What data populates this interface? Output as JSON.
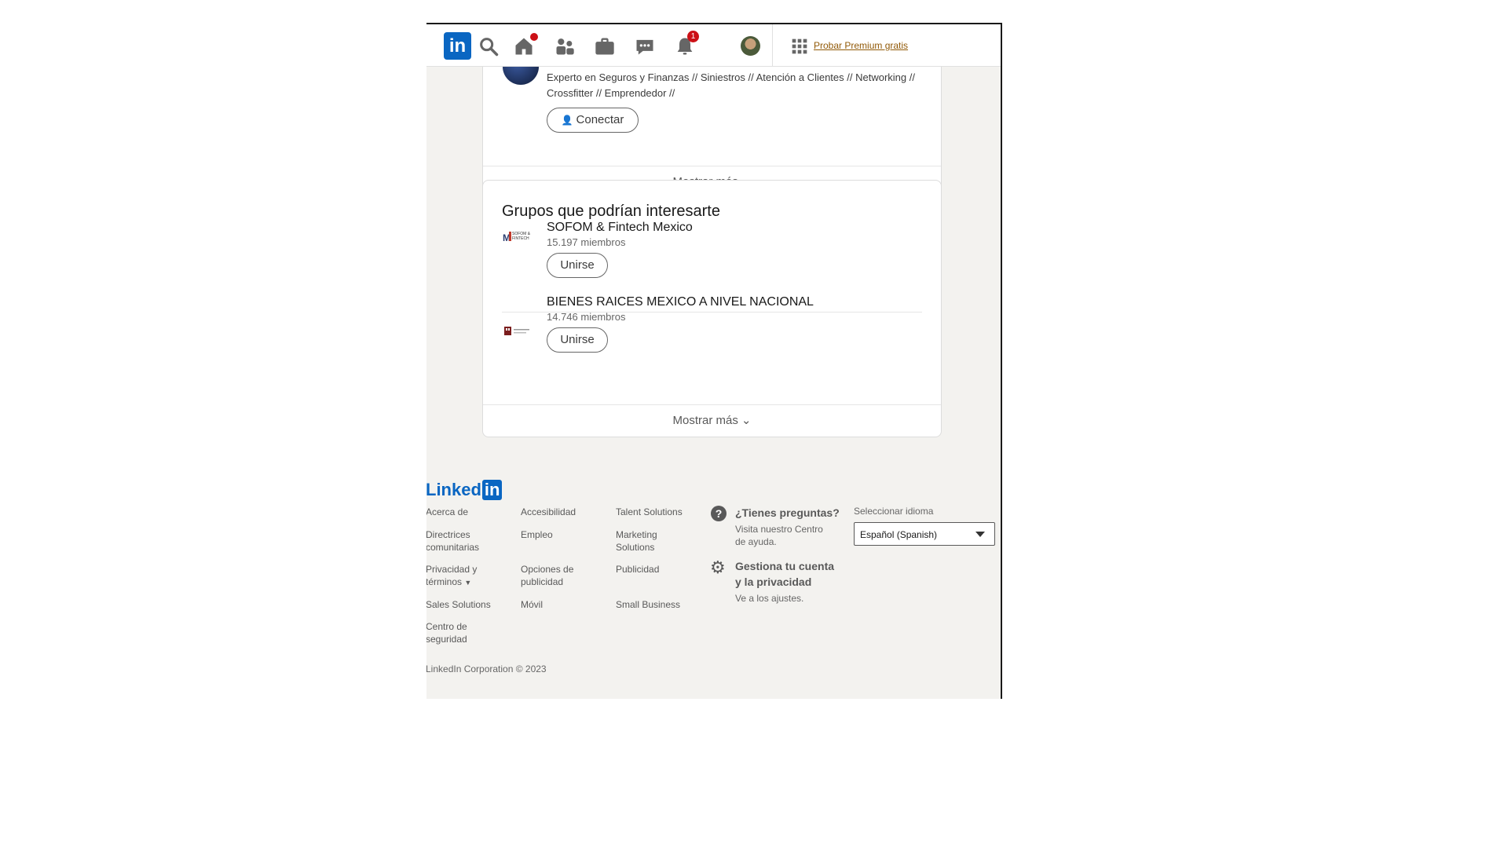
{
  "nav": {
    "logo": "in",
    "messaging_badge": "",
    "home_badge": "",
    "notifications_badge": "1",
    "premium_link": "Probar Premium gratis"
  },
  "people_card": {
    "headline": "Experto en Seguros y Finanzas // Siniestros // Atención a Clientes // Networking // Crossfitter // Emprendedor //",
    "connect_label": "Conectar",
    "show_more": "Mostrar más"
  },
  "groups_card": {
    "title": "Grupos que podrían interesarte",
    "groups": [
      {
        "name": "SOFOM & Fintech Mexico",
        "members": "15.197 miembros",
        "join_label": "Unirse",
        "logo_text": "SOFOM & FINTECH"
      },
      {
        "name": "BIENES RAICES MEXICO A NIVEL NACIONAL",
        "members": "14.746 miembros",
        "join_label": "Unirse"
      }
    ],
    "show_more": "Mostrar más"
  },
  "footer": {
    "logo_text": "Linked",
    "logo_box": "in",
    "col1": [
      "Acerca de",
      "Directrices comunitarias",
      "Privacidad y términos",
      "Sales Solutions",
      "Centro de seguridad"
    ],
    "col2": [
      "Accesibilidad",
      "Empleo",
      "Opciones de publicidad",
      "Móvil"
    ],
    "col3": [
      "Talent Solutions",
      "Marketing Solutions",
      "Publicidad",
      "Small Business"
    ],
    "help": {
      "title": "¿Tienes preguntas?",
      "subtitle": "Visita nuestro Centro de ayuda."
    },
    "account": {
      "title": "Gestiona tu cuenta y la privacidad",
      "subtitle": "Ve a los ajustes."
    },
    "language": {
      "label": "Seleccionar idioma",
      "selected": "Español (Spanish)"
    },
    "copyright": "LinkedIn Corporation © 2023"
  },
  "colors": {
    "brand": "#0a66c2",
    "badge": "#cc1016",
    "premium": "#915907",
    "page_bg": "#f3f2ef"
  }
}
